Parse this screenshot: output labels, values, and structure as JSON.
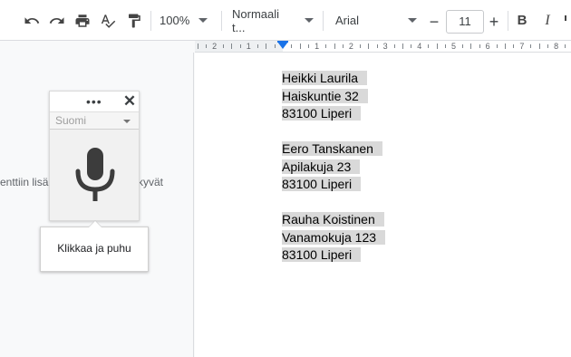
{
  "toolbar": {
    "icons": [
      "undo-icon",
      "redo-icon",
      "print-icon",
      "spellcheck-icon",
      "paint-format-icon",
      "bold-icon",
      "italic-icon"
    ],
    "zoom": "100%",
    "style": "Normaali t...",
    "font": "Arial",
    "font_size": "11",
    "minus": "−",
    "plus": "+",
    "bold": "B",
    "italic": "I"
  },
  "ruler": {
    "numbers": [
      "2",
      "1",
      "1",
      "2",
      "3",
      "4",
      "5",
      "6",
      "7",
      "8"
    ]
  },
  "background_text": {
    "left": "enttiin lisä",
    "right": "kyvät"
  },
  "voice": {
    "menu": "•••",
    "close": "✕",
    "language": "Suomi",
    "tooltip": "Klikkaa ja puhu"
  },
  "document": {
    "lines": [
      "Heikki Laurila",
      "Haiskuntie 32",
      "83100 Liperi",
      "",
      "Eero Tanskanen",
      "Apilakuja 23",
      "83100 Liperi",
      "",
      "Rauha Koistinen",
      "Vanamokuja 123",
      "83100 Liperi"
    ]
  },
  "colors": {
    "accent": "#1a73e8",
    "selection": "#d9d9d9"
  }
}
